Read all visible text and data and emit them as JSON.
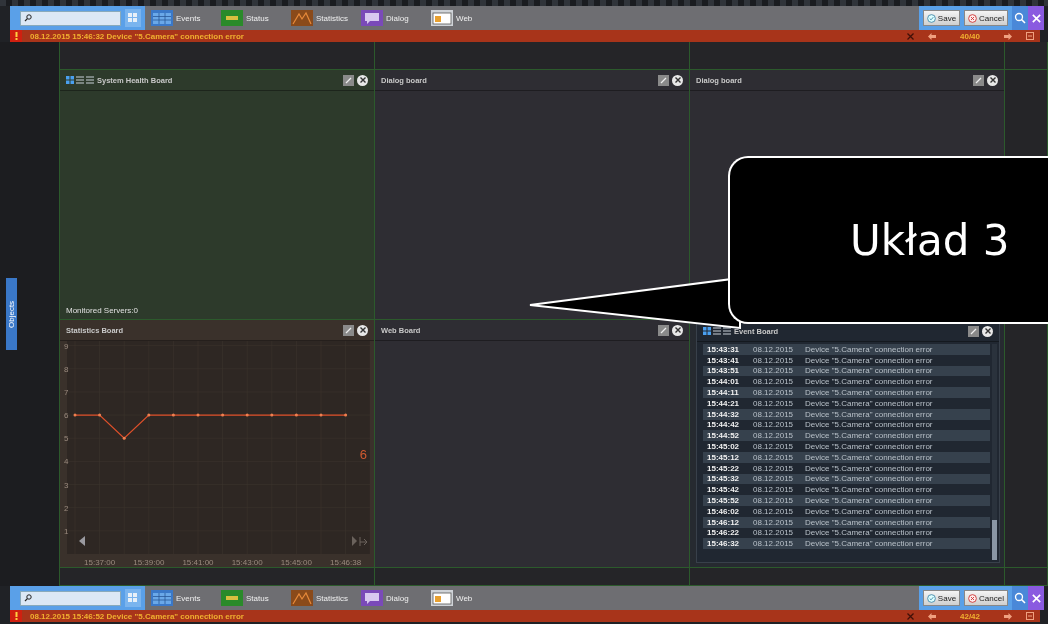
{
  "top_toolbar": {
    "tabs": [
      {
        "label": "Events",
        "kind": "events"
      },
      {
        "label": "Status",
        "kind": "status"
      },
      {
        "label": "Statistics",
        "kind": "statistics"
      },
      {
        "label": "Dialog",
        "kind": "dialog"
      },
      {
        "label": "Web",
        "kind": "web"
      }
    ],
    "save": "Save",
    "cancel": "Cancel"
  },
  "top_alert": {
    "message": "08.12.2015 15:46:32 Device \"5.Camera\" connection error",
    "counter": "40/40"
  },
  "side_tab": "Objects",
  "boards": [
    {
      "kind": "health",
      "title": "System Health Board",
      "footer": "Monitored Servers:0"
    },
    {
      "kind": "dialog",
      "title": "Dialog board"
    },
    {
      "kind": "dialog",
      "title": "Dialog board"
    },
    {
      "kind": "statistics",
      "title": "Statistics Board",
      "current_value": "6",
      "chart_data": {
        "type": "line",
        "grid": true,
        "categories": [
          null,
          "15:37:00",
          null,
          "15:39:00",
          null,
          "15:41:00",
          null,
          "15:43:00",
          null,
          "15:45:00",
          null,
          "15:46:38"
        ],
        "series": [
          {
            "color": "#e0502a",
            "values": [
              6,
              6,
              5,
              6,
              6,
              6,
              6,
              6,
              6,
              6,
              6,
              6
            ]
          }
        ],
        "ylim": [
          0,
          9.2
        ],
        "yticks": [
          1,
          2,
          3,
          4,
          5,
          6,
          7,
          8,
          9
        ]
      }
    },
    {
      "kind": "web",
      "title": "Web Board"
    },
    {
      "kind": "event",
      "title": "Event Board",
      "events": [
        {
          "time": "15:43:31",
          "date": "08.12.2015",
          "message": "Device \"5.Camera\" connection error"
        },
        {
          "time": "15:43:41",
          "date": "08.12.2015",
          "message": "Device \"5.Camera\" connection error"
        },
        {
          "time": "15:43:51",
          "date": "08.12.2015",
          "message": "Device \"5.Camera\" connection error"
        },
        {
          "time": "15:44:01",
          "date": "08.12.2015",
          "message": "Device \"5.Camera\" connection error"
        },
        {
          "time": "15:44:11",
          "date": "08.12.2015",
          "message": "Device \"5.Camera\" connection error"
        },
        {
          "time": "15:44:21",
          "date": "08.12.2015",
          "message": "Device \"5.Camera\" connection error"
        },
        {
          "time": "15:44:32",
          "date": "08.12.2015",
          "message": "Device \"5.Camera\" connection error"
        },
        {
          "time": "15:44:42",
          "date": "08.12.2015",
          "message": "Device \"5.Camera\" connection error"
        },
        {
          "time": "15:44:52",
          "date": "08.12.2015",
          "message": "Device \"5.Camera\" connection error"
        },
        {
          "time": "15:45:02",
          "date": "08.12.2015",
          "message": "Device \"5.Camera\" connection error"
        },
        {
          "time": "15:45:12",
          "date": "08.12.2015",
          "message": "Device \"5.Camera\" connection error"
        },
        {
          "time": "15:45:22",
          "date": "08.12.2015",
          "message": "Device \"5.Camera\" connection error"
        },
        {
          "time": "15:45:32",
          "date": "08.12.2015",
          "message": "Device \"5.Camera\" connection error"
        },
        {
          "time": "15:45:42",
          "date": "08.12.2015",
          "message": "Device \"5.Camera\" connection error"
        },
        {
          "time": "15:45:52",
          "date": "08.12.2015",
          "message": "Device \"5.Camera\" connection error"
        },
        {
          "time": "15:46:02",
          "date": "08.12.2015",
          "message": "Device \"5.Camera\" connection error"
        },
        {
          "time": "15:46:12",
          "date": "08.12.2015",
          "message": "Device \"5.Camera\" connection error"
        },
        {
          "time": "15:46:22",
          "date": "08.12.2015",
          "message": "Device \"5.Camera\" connection error"
        },
        {
          "time": "15:46:32",
          "date": "08.12.2015",
          "message": "Device \"5.Camera\" connection error"
        }
      ]
    }
  ],
  "bottom_toolbar": {
    "tabs": [
      {
        "label": "Events",
        "kind": "events"
      },
      {
        "label": "Status",
        "kind": "status"
      },
      {
        "label": "Statistics",
        "kind": "statistics"
      },
      {
        "label": "Dialog",
        "kind": "dialog"
      },
      {
        "label": "Web",
        "kind": "web"
      }
    ],
    "save": "Save",
    "cancel": "Cancel"
  },
  "bottom_alert": {
    "message": "08.12.2015 15:46:52 Device \"5.Camera\" connection error",
    "counter": "42/42"
  },
  "callout": "Układ 3"
}
